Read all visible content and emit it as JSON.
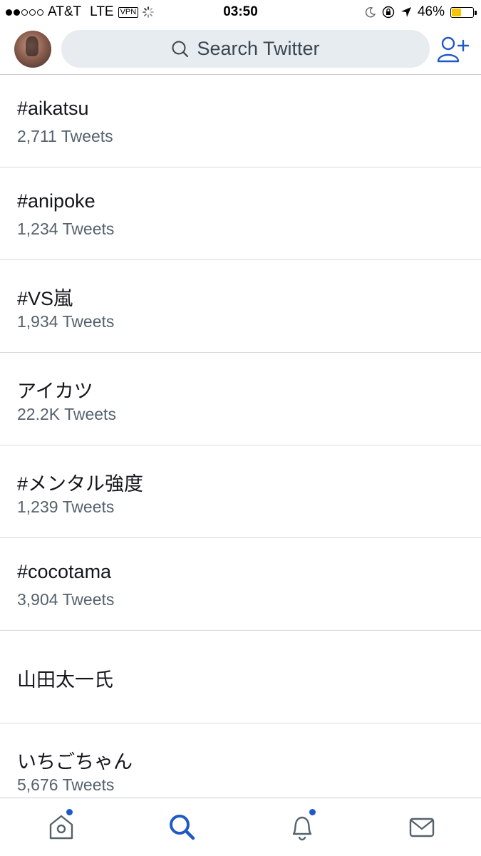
{
  "status_bar": {
    "carrier": "AT&T",
    "network": "LTE",
    "vpn": "VPN",
    "time": "03:50",
    "battery_text": "46%",
    "battery_level": 0.46
  },
  "header": {
    "search_placeholder": "Search Twitter"
  },
  "trends": [
    {
      "name": "#aikatsu",
      "count": "2,711 Tweets"
    },
    {
      "name": "#anipoke",
      "count": "1,234 Tweets"
    },
    {
      "name": "#VS嵐",
      "count": "1,934 Tweets"
    },
    {
      "name": "アイカツ",
      "count": "22.2K Tweets"
    },
    {
      "name": "#メンタル強度",
      "count": "1,239 Tweets"
    },
    {
      "name": "#cocotama",
      "count": "3,904 Tweets"
    },
    {
      "name": "山田太一氏",
      "count": ""
    },
    {
      "name": "いちごちゃん",
      "count": "5,676 Tweets"
    }
  ],
  "tab_bar": {
    "tabs": [
      "home-icon",
      "search-icon",
      "notifications-icon",
      "messages-icon"
    ],
    "active_tab": "search-icon"
  },
  "colors": {
    "accent": "#1f5ac4",
    "search_bg": "#e6ecf0",
    "battery": "#f5c400"
  }
}
